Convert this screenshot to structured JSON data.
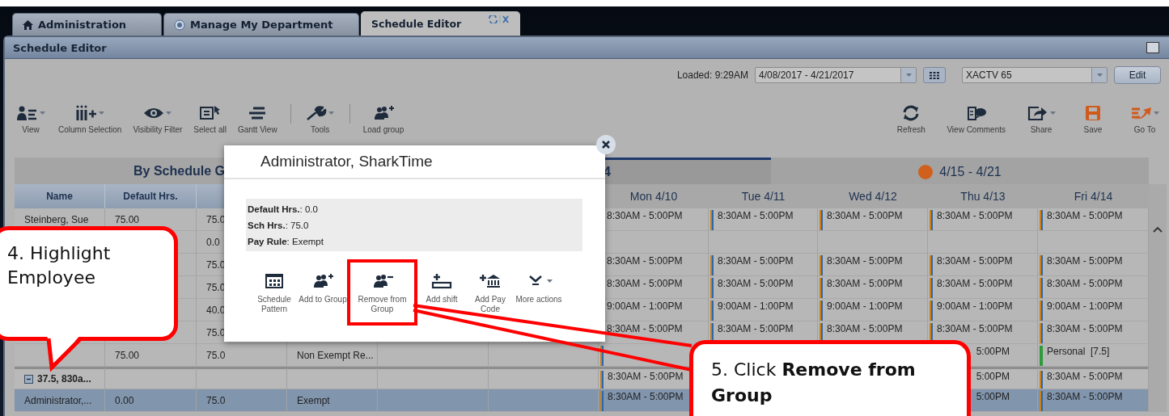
{
  "tabs": [
    {
      "label": "Administration",
      "selected": false
    },
    {
      "label": "Manage My Department",
      "selected": false
    },
    {
      "label": "Schedule Editor",
      "selected": true
    }
  ],
  "window": {
    "title": "Schedule Editor"
  },
  "header": {
    "loaded": "Loaded: 9:29AM",
    "date_range": "4/08/2017 - 4/21/2017",
    "location": "XACTV 65",
    "edit_button": "Edit"
  },
  "toolbar_left": [
    {
      "label": "View",
      "menu": true
    },
    {
      "label": "Column Selection",
      "menu": true
    },
    {
      "label": "Visibility Filter",
      "menu": true
    },
    {
      "label": "Select all",
      "menu": false
    },
    {
      "label": "Gantt View",
      "menu": false
    },
    {
      "label": "Tools",
      "menu": true
    },
    {
      "label": "Load group",
      "menu": false
    }
  ],
  "toolbar_right": [
    {
      "label": "Refresh",
      "menu": false
    },
    {
      "label": "View Comments",
      "menu": false
    },
    {
      "label": "Share",
      "menu": true
    },
    {
      "label": "Save",
      "menu": false
    },
    {
      "label": "Go To",
      "menu": true
    }
  ],
  "table": {
    "group_title": "By Schedule G",
    "columns": [
      "Name",
      "Default Hrs."
    ],
    "weeks": [
      {
        "label": "4",
        "selected": true
      },
      {
        "label": "4/15 - 4/21",
        "selected": false,
        "color": "#d0601c"
      }
    ],
    "days": [
      "Mon 4/10",
      "Tue 4/11",
      "Wed 4/12",
      "Thu 4/13",
      "Fri 4/14"
    ],
    "rows": [
      {
        "kind": "employee",
        "selected": false,
        "name": "Steinberg, Sue",
        "default_hrs": "75.00",
        "sch_hrs": "75.0",
        "days": [
          {
            "kind": "plain",
            "text": "8:30AM - 5:00PM"
          },
          {
            "kind": "shift",
            "text": "8:30AM - 5:00PM"
          },
          {
            "kind": "shift",
            "text": "8:30AM - 5:00PM"
          },
          {
            "kind": "shift",
            "text": "8:30AM - 5:00PM"
          },
          {
            "kind": "shift",
            "text": "8:30AM - 5:00PM"
          }
        ]
      },
      {
        "kind": "employee",
        "selected": false,
        "sch_hrs": "0.0",
        "days": [
          {
            "kind": "blank"
          },
          {
            "kind": "blank"
          },
          {
            "kind": "blank"
          },
          {
            "kind": "blank"
          },
          {
            "kind": "blank"
          }
        ]
      },
      {
        "kind": "employee",
        "selected": false,
        "sch_hrs": "75.0",
        "days": [
          {
            "kind": "plain",
            "text": "8:30AM - 5:00PM"
          },
          {
            "kind": "shift",
            "text": "8:30AM - 5:00PM"
          },
          {
            "kind": "shift",
            "text": "8:30AM - 5:00PM"
          },
          {
            "kind": "shift",
            "text": "8:30AM - 5:00PM"
          },
          {
            "kind": "shift",
            "text": "8:30AM - 5:00PM"
          }
        ]
      },
      {
        "kind": "employee",
        "selected": false,
        "sch_hrs": "75.0",
        "days": [
          {
            "kind": "plain",
            "text": "8:30AM - 5:00PM"
          },
          {
            "kind": "shift",
            "text": "8:30AM - 5:00PM"
          },
          {
            "kind": "shift",
            "text": "8:30AM - 5:00PM"
          },
          {
            "kind": "shift",
            "text": "8:30AM - 5:00PM"
          },
          {
            "kind": "shift",
            "text": "8:30AM - 5:00PM"
          }
        ]
      },
      {
        "kind": "employee",
        "selected": false,
        "sch_hrs": "40.0",
        "days": [
          {
            "kind": "plain",
            "text": "9:00AM - 1:00PM"
          },
          {
            "kind": "shift",
            "text": "9:00AM - 1:00PM"
          },
          {
            "kind": "shift",
            "text": "9:00AM - 1:00PM"
          },
          {
            "kind": "shift",
            "text": "9:00AM - 1:00PM"
          },
          {
            "kind": "shift",
            "text": "9:00AM - 1:00PM"
          }
        ]
      },
      {
        "kind": "employee",
        "selected": false,
        "sch_hrs": "75.0",
        "days": [
          {
            "kind": "plain",
            "text": "8:30AM - 5:00PM"
          },
          {
            "kind": "shift",
            "text": "8:30AM - 5:00PM"
          },
          {
            "kind": "shift",
            "text": "8:30AM - 5:00PM"
          },
          {
            "kind": "shift",
            "text": "8:30AM - 5:00PM"
          },
          {
            "kind": "shift",
            "text": "8:30AM - 5:00PM"
          }
        ]
      },
      {
        "kind": "employee",
        "selected": false,
        "default_hrs": "75.00",
        "sch_hrs": "75.0",
        "pay_rule": "Non Exempt Re...",
        "days": [
          {
            "kind": "shift"
          },
          {
            "kind": "blank"
          },
          {
            "kind": "blank"
          },
          {
            "kind": "partial",
            "text": "5:00PM"
          },
          {
            "kind": "paycode",
            "text": "Personal  [7.5]"
          }
        ]
      },
      {
        "kind": "group",
        "selected": false,
        "expanded": true,
        "name": "37.5, 830a...",
        "days": [
          {
            "kind": "shift",
            "text": "8:30AM - 5:00PM"
          },
          {
            "kind": "blank"
          },
          {
            "kind": "blank"
          },
          {
            "kind": "partial",
            "text": "5:00PM"
          },
          {
            "kind": "shift",
            "text": "8:30AM - 5:00PM"
          }
        ]
      },
      {
        "kind": "employee",
        "selected": true,
        "name": "Administrator,...",
        "default_hrs": "0.00",
        "sch_hrs": "75.0",
        "pay_rule": "Exempt",
        "days": [
          {
            "kind": "shift",
            "text": "8:30AM - 5:00PM"
          },
          {
            "kind": "blank"
          },
          {
            "kind": "blank"
          },
          {
            "kind": "partial",
            "text": "5:00PM"
          },
          {
            "kind": "shift",
            "text": "8:30AM - 5:00PM"
          }
        ]
      }
    ]
  },
  "popup": {
    "title": "Administrator, SharkTime",
    "details": [
      "**Default Hrs.**: 0.0",
      "**Sch Hrs.**: 75.0",
      "**Pay Rule**: Exempt"
    ],
    "actions": [
      {
        "label": "Schedule Pattern",
        "menu": false,
        "highlighted": false
      },
      {
        "label": "Add to Group",
        "menu": false,
        "highlighted": false
      },
      {
        "label": "Remove from Group",
        "menu": false,
        "highlighted": true
      },
      {
        "label": "Add shift",
        "menu": false,
        "highlighted": false
      },
      {
        "label": "Add Pay Code",
        "menu": false,
        "highlighted": false
      },
      {
        "label": "More actions",
        "menu": true,
        "highlighted": false
      }
    ]
  },
  "callouts": [
    {
      "text": "4. Highlight Employee"
    },
    {
      "text": "5. Click **Remove from Group**"
    }
  ]
}
